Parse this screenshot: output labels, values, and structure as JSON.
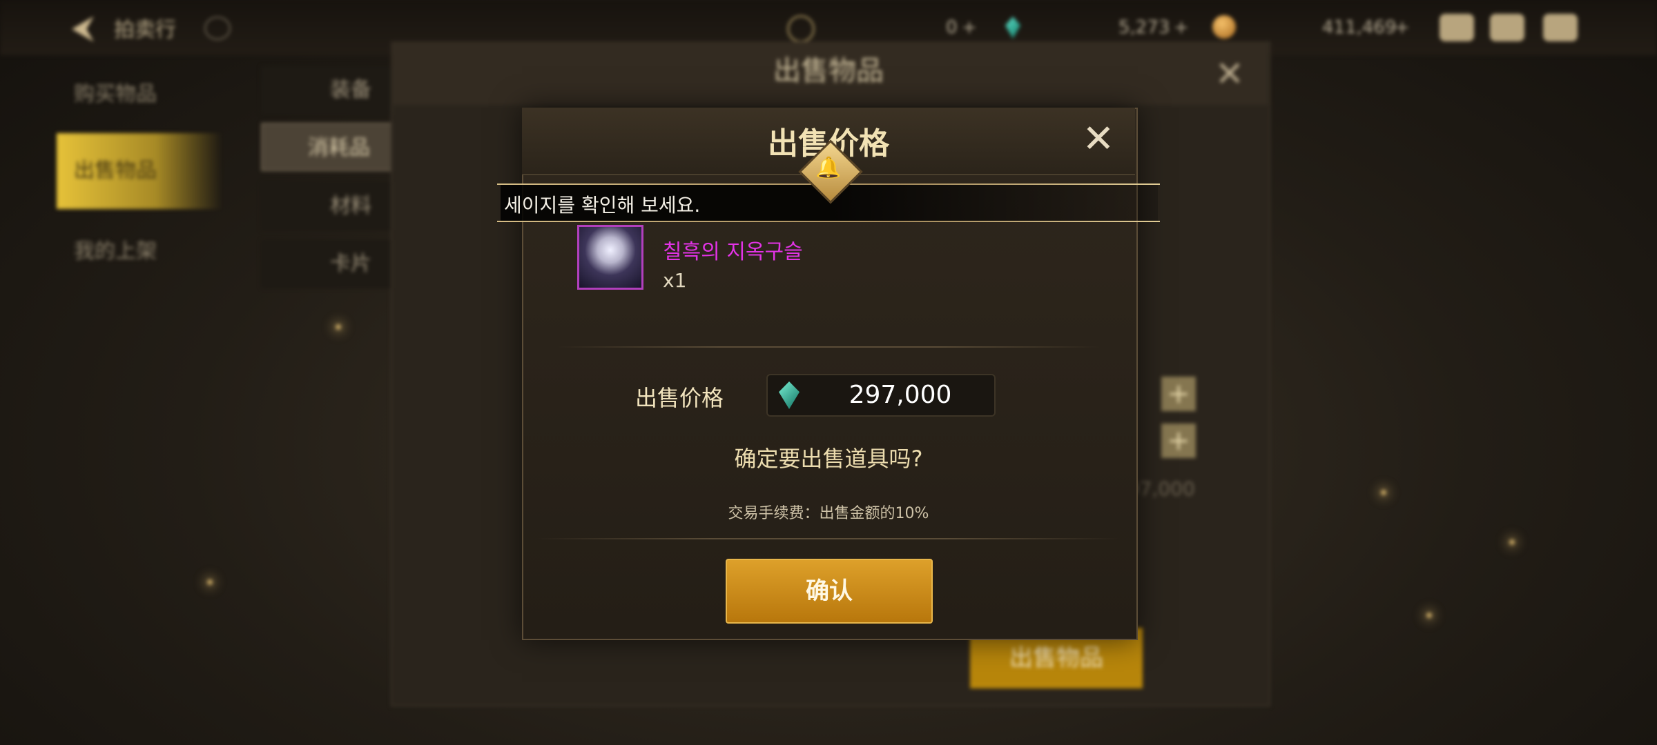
{
  "topbar": {
    "title": "拍卖行",
    "currency_c_amount": "0",
    "gem_amount": "5,273",
    "gold_amount": "411,469",
    "plus": "+"
  },
  "sidebar": {
    "items": [
      {
        "label": "购买物品"
      },
      {
        "label": "出售物品"
      },
      {
        "label": "我的上架"
      }
    ]
  },
  "categories": [
    {
      "label": "装备"
    },
    {
      "label": "消耗品"
    },
    {
      "label": "材料"
    },
    {
      "label": "卡片"
    }
  ],
  "background_panel": {
    "title": "出售物品",
    "sell_button": "出售物品",
    "total": "297,000"
  },
  "notice": {
    "text": "세이지를 확인해 보세요."
  },
  "modal": {
    "title": "出售价格",
    "item_name": "칠흑의 지옥구슬",
    "item_qty": "x1",
    "price_label": "出售价格",
    "price_value": "297,000",
    "question": "确定要出售道具吗?",
    "fee_note": "交易手续费：出售金额的10%",
    "confirm_label": "确认"
  },
  "colors": {
    "accent_gold": "#c98d18",
    "item_name_magenta": "#e233e6",
    "gem_teal": "#3fc9a8"
  }
}
